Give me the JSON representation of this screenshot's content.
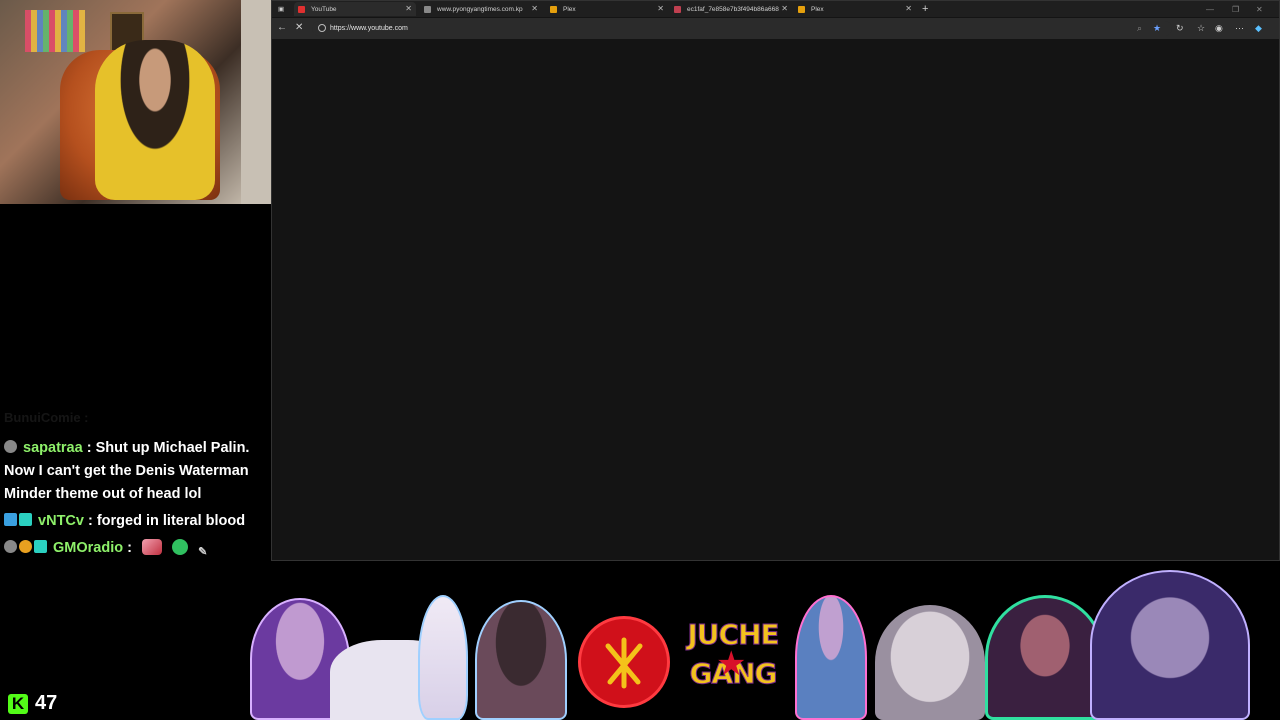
{
  "browser": {
    "tabs": [
      {
        "title": "YouTube",
        "active": true
      },
      {
        "title": "www.pyongyangtimes.com.kp",
        "active": false
      },
      {
        "title": "Plex",
        "active": false
      },
      {
        "title": "ec1faf_7e858e7b3f494b86a6686c",
        "active": false
      },
      {
        "title": "Plex",
        "active": false
      }
    ],
    "address": "https://www.youtube.com"
  },
  "chat": {
    "ghost": "BunuiComie :",
    "messages": [
      {
        "user": "sapatraa",
        "text": ": Shut up Michael Palin. Now I can't get the Denis Waterman Minder theme out of head lol"
      },
      {
        "user": "vNTCv",
        "text": ": forged in literal blood"
      },
      {
        "user": "GMOradio",
        "text": ":"
      }
    ]
  },
  "overlay": {
    "banner_line1": "JUCHE",
    "banner_line2": "GANG",
    "kick_viewers": "47"
  },
  "colors": {
    "username": "#8ef06a",
    "kick": "#53fc18",
    "browser_bg": "#141414"
  }
}
